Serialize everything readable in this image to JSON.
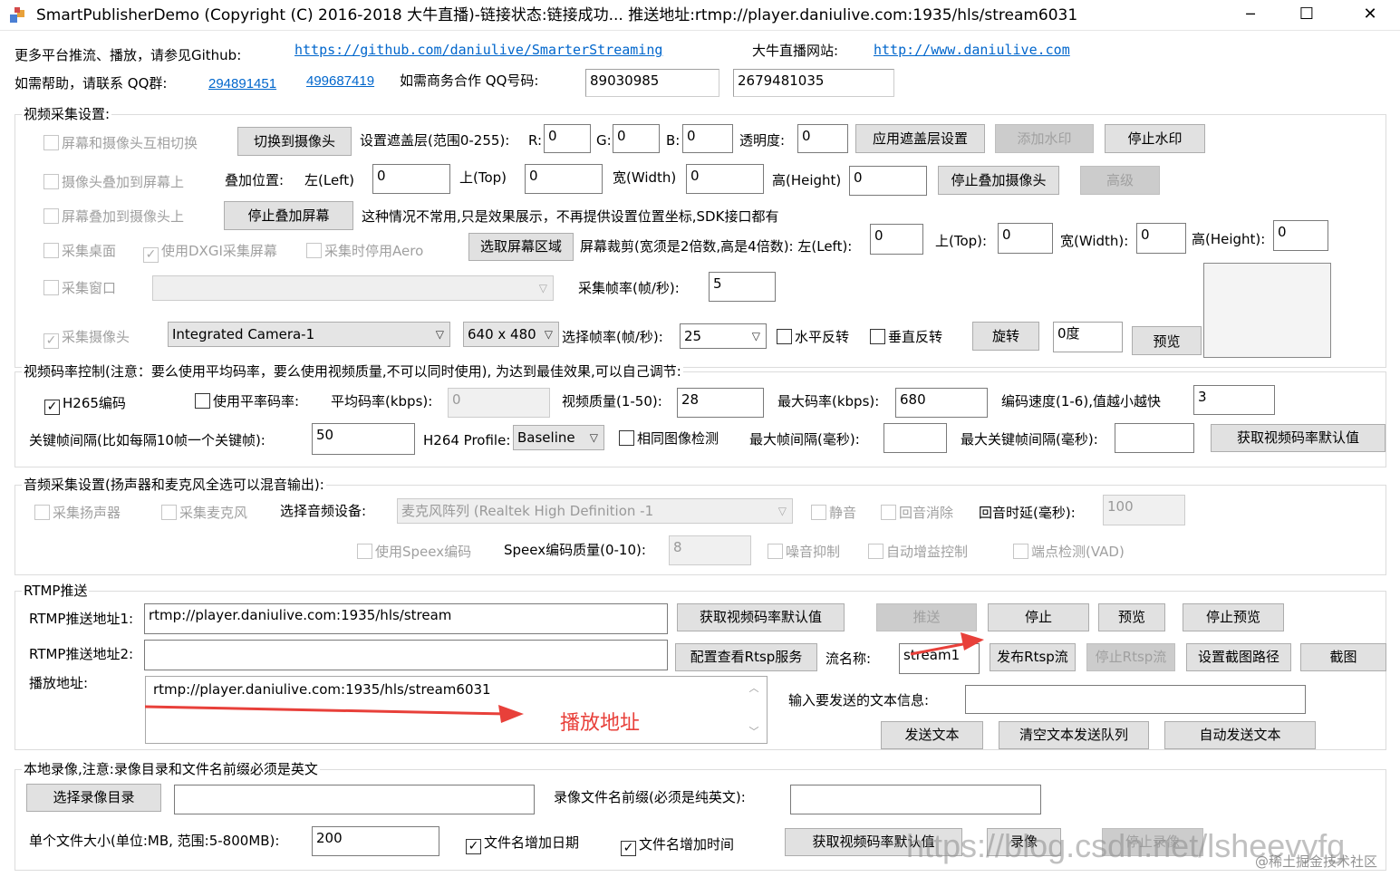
{
  "window": {
    "title": "SmartPublisherDemo  (Copyright (C) 2016-2018 大牛直播)-链接状态:链接成功... 推送地址:rtmp://player.daniulive.com:1935/hls/stream6031",
    "minimize": "─",
    "maximize": "☐",
    "close": "✕"
  },
  "header": {
    "github_label": "更多平台推流、播放，请参见Github:",
    "github_url": "https://github.com/daniulive/SmarterStreaming",
    "site_label": "大牛直播网站:",
    "site_url": "http://www.daniulive.com",
    "help_label": "如需帮助，请联系 QQ群:",
    "qq_group1": "294891451",
    "qq_group2": "499687419",
    "biz_label": "如需商务合作 QQ号码:",
    "biz_qq1": "89030985",
    "biz_qq2": "2679481035"
  },
  "video": {
    "group_label": "视频采集设置:",
    "screen_cam_switch": "屏幕和摄像头互相切换",
    "switch_cam_btn": "切换到摄像头",
    "overlay_label": "设置遮盖层(范围0-255):",
    "r_label": "R:",
    "r_val": "0",
    "g_label": "G:",
    "g_val": "0",
    "b_label": "B:",
    "b_val": "0",
    "alpha_label": "透明度:",
    "alpha_val": "0",
    "apply_overlay_btn": "应用遮盖层设置",
    "add_wm_btn": "添加水印",
    "stop_wm_btn": "停止水印",
    "cam_on_screen": "摄像头叠加到屏幕上",
    "pos_label": "叠加位置:",
    "left_label": "左(Left)",
    "left_val": "0",
    "top_label": "上(Top)",
    "top_val": "0",
    "width_label": "宽(Width)",
    "width_val": "0",
    "height_label": "高(Height)",
    "height_val": "0",
    "stop_cam_overlay_btn": "停止叠加摄像头",
    "advanced_btn": "高级",
    "screen_on_cam": "屏幕叠加到摄像头上",
    "stop_screen_overlay_btn": "停止叠加屏幕",
    "note": "这种情况不常用,只是效果展示，不再提供设置位置坐标,SDK接口都有",
    "capture_desktop": "采集桌面",
    "use_dxgi": "使用DXGI采集屏幕",
    "disable_aero": "采集时停用Aero",
    "select_region_btn": "选取屏幕区域",
    "crop_label": "屏幕裁剪(宽须是2倍数,高是4倍数): 左(Left):",
    "crop_left": "0",
    "crop_top_label": "上(Top):",
    "crop_top": "0",
    "crop_width_label": "宽(Width):",
    "crop_width": "0",
    "crop_height_label": "高(Height):",
    "crop_height": "0",
    "capture_window": "采集窗口",
    "window_select": "",
    "fps_label": "采集帧率(帧/秒):",
    "fps_val": "5",
    "capture_camera": "采集摄像头",
    "camera_select": "Integrated Camera-1",
    "resolution_select": "640 x 480",
    "sel_fps_label": "选择帧率(帧/秒):",
    "sel_fps_val": "25",
    "hflip": "水平反转",
    "vflip": "垂直反转",
    "rotate_btn": "旋转",
    "rotate_val": "0度",
    "preview_btn": "预览"
  },
  "bitrate": {
    "group_label": "视频码率控制(注意：要么使用平均码率，要么使用视频质量,不可以同时使用), 为达到最佳效果,可以自己调节:",
    "h265": "H265编码",
    "use_avg": "使用平率码率:",
    "avg_label": "平均码率(kbps):",
    "avg_val": "0",
    "quality_label": "视频质量(1-50):",
    "quality_val": "28",
    "max_label": "最大码率(kbps):",
    "max_val": "680",
    "speed_label": "编码速度(1-6),值越小越快",
    "speed_val": "3",
    "gop_label": "关键帧间隔(比如每隔10帧一个关键帧):",
    "gop_val": "50",
    "profile_label": "H264 Profile:",
    "profile_val": "Baseline",
    "same_img": "相同图像检测",
    "max_frame_label": "最大帧间隔(毫秒):",
    "max_frame_val": "",
    "max_key_label": "最大关键帧间隔(毫秒):",
    "max_key_val": "",
    "get_default_btn": "获取视频码率默认值"
  },
  "audio": {
    "group_label": "音频采集设置(扬声器和麦克风全选可以混音输出):",
    "speaker": "采集扬声器",
    "mic": "采集麦克风",
    "device_label": "选择音频设备:",
    "device_val": "麦克风阵列 (Realtek High Definition -1",
    "mute": "静音",
    "echo_cancel": "回音消除",
    "echo_delay_label": "回音时延(毫秒):",
    "echo_delay_val": "100",
    "speex": "使用Speex编码",
    "speex_q_label": "Speex编码质量(0-10):",
    "speex_q_val": "8",
    "noise": "噪音抑制",
    "agc": "自动增益控制",
    "vad": "端点检测(VAD)"
  },
  "rtmp": {
    "group_label": "RTMP推送",
    "url1_label": "RTMP推送地址1:",
    "url1_val": "rtmp://player.daniulive.com:1935/hls/stream",
    "get_default_btn": "获取视频码率默认值",
    "push_btn": "推送",
    "stop_btn": "停止",
    "preview_btn": "预览",
    "stop_preview_btn": "停止预览",
    "url2_label": "RTMP推送地址2:",
    "url2_val": "",
    "rtsp_cfg_btn": "配置查看Rtsp服务",
    "stream_label": "流名称:",
    "stream_val": "stream1",
    "pub_rtsp_btn": "发布Rtsp流",
    "stop_rtsp_btn": "停止Rtsp流",
    "snap_path_btn": "设置截图路径",
    "snap_btn": "截图",
    "play_label": "播放地址:",
    "play_val": "rtmp://player.daniulive.com:1935/hls/stream6031",
    "annotation": "播放地址",
    "text_label": "输入要发送的文本信息:",
    "text_val": "",
    "send_text_btn": "发送文本",
    "clear_queue_btn": "清空文本发送队列",
    "auto_send_btn": "自动发送文本"
  },
  "record": {
    "group_label": "本地录像,注意:录像目录和文件名前缀必须是英文",
    "select_dir_btn": "选择录像目录",
    "dir_val": "",
    "prefix_label": "录像文件名前缀(必须是纯英文):",
    "prefix_val": "",
    "size_label": "单个文件大小(单位:MB, 范围:5-800MB):",
    "size_val": "200",
    "add_date": "文件名增加日期",
    "add_time": "文件名增加时间",
    "get_default_btn": "获取视频码率默认值",
    "rec_btn": "录像",
    "stop_rec_btn": "停止录像"
  },
  "watermark": {
    "csdn": "https://blog.csdn.net/lsheevyfg",
    "juejin": "@稀土掘金技术社区"
  },
  "colors": {
    "accent_red": "#e8403a",
    "link": "#0066cc",
    "disabled": "#a0a0a0"
  }
}
